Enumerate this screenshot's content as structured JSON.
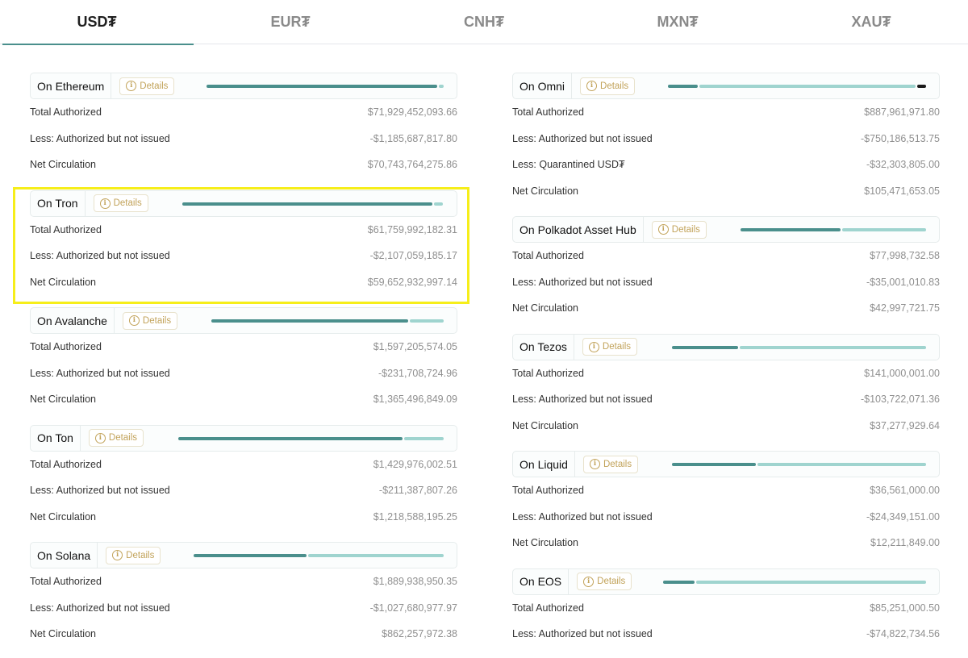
{
  "tabs": [
    "USD₮",
    "EUR₮",
    "CNH₮",
    "MXN₮",
    "XAU₮"
  ],
  "active_tab": "USD₮",
  "details_label": "Details",
  "left": [
    {
      "name": "On Ethereum",
      "rows": [
        {
          "label": "Total Authorized",
          "value": "$71,929,452,093.66"
        },
        {
          "label": "Less: Authorized but not issued",
          "value": "-$1,185,687,817.80"
        },
        {
          "label": "Net Circulation",
          "value": "$70,743,764,275.86"
        }
      ]
    },
    {
      "name": "On Tron",
      "rows": [
        {
          "label": "Total Authorized",
          "value": "$61,759,992,182.31"
        },
        {
          "label": "Less: Authorized but not issued",
          "value": "-$2,107,059,185.17"
        },
        {
          "label": "Net Circulation",
          "value": "$59,652,932,997.14"
        }
      ]
    },
    {
      "name": "On Avalanche",
      "rows": [
        {
          "label": "Total Authorized",
          "value": "$1,597,205,574.05"
        },
        {
          "label": "Less: Authorized but not issued",
          "value": "-$231,708,724.96"
        },
        {
          "label": "Net Circulation",
          "value": "$1,365,496,849.09"
        }
      ]
    },
    {
      "name": "On Ton",
      "rows": [
        {
          "label": "Total Authorized",
          "value": "$1,429,976,002.51"
        },
        {
          "label": "Less: Authorized but not issued",
          "value": "-$211,387,807.26"
        },
        {
          "label": "Net Circulation",
          "value": "$1,218,588,195.25"
        }
      ]
    },
    {
      "name": "On Solana",
      "rows": [
        {
          "label": "Total Authorized",
          "value": "$1,889,938,950.35"
        },
        {
          "label": "Less: Authorized but not issued",
          "value": "-$1,027,680,977.97"
        },
        {
          "label": "Net Circulation",
          "value": "$862,257,972.38"
        }
      ]
    }
  ],
  "right": [
    {
      "name": "On Omni",
      "rows": [
        {
          "label": "Total Authorized",
          "value": "$887,961,971.80"
        },
        {
          "label": "Less: Authorized but not issued",
          "value": "-$750,186,513.75"
        },
        {
          "label": "Less: Quarantined USD₮",
          "value": "-$32,303,805.00"
        },
        {
          "label": "Net Circulation",
          "value": "$105,471,653.05"
        }
      ]
    },
    {
      "name": "On Polkadot Asset Hub",
      "rows": [
        {
          "label": "Total Authorized",
          "value": "$77,998,732.58"
        },
        {
          "label": "Less: Authorized but not issued",
          "value": "-$35,001,010.83"
        },
        {
          "label": "Net Circulation",
          "value": "$42,997,721.75"
        }
      ]
    },
    {
      "name": "On Tezos",
      "rows": [
        {
          "label": "Total Authorized",
          "value": "$141,000,001.00"
        },
        {
          "label": "Less: Authorized but not issued",
          "value": "-$103,722,071.36"
        },
        {
          "label": "Net Circulation",
          "value": "$37,277,929.64"
        }
      ]
    },
    {
      "name": "On Liquid",
      "rows": [
        {
          "label": "Total Authorized",
          "value": "$36,561,000.00"
        },
        {
          "label": "Less: Authorized but not issued",
          "value": "-$24,349,151.00"
        },
        {
          "label": "Net Circulation",
          "value": "$12,211,849.00"
        }
      ]
    },
    {
      "name": "On EOS",
      "rows": [
        {
          "label": "Total Authorized",
          "value": "$85,251,000.50"
        },
        {
          "label": "Less: Authorized but not issued",
          "value": "-$74,822,734.56"
        }
      ]
    }
  ],
  "colors": {
    "accent": "#4a8f8c",
    "accent_light": "#9fd4cf",
    "details": "#c2a35a",
    "highlight": "#f6ee1a"
  }
}
